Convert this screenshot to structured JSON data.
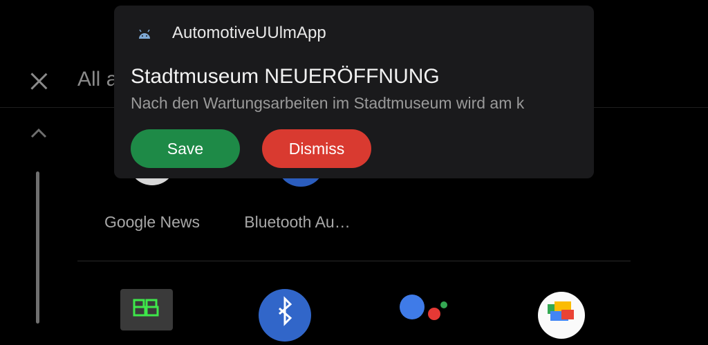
{
  "launcher": {
    "header_title": "All apps",
    "apps_row1": [
      {
        "label": "Google News",
        "icon": "google-news-icon"
      },
      {
        "label": "Bluetooth Au…",
        "icon": "bluetooth-audio-icon"
      }
    ],
    "apps_row2_icons": [
      "app-green-icon",
      "bluetooth-icon",
      "google-assistant-icon",
      "google-photos-icon"
    ]
  },
  "notification": {
    "app_name": "AutomotiveUUlmApp",
    "app_icon": "android-icon",
    "title": "Stadtmuseum NEUERÖFFNUNG",
    "body": "Nach den Wartungsarbeiten im Stadtmuseum wird am k",
    "actions": {
      "save_label": "Save",
      "dismiss_label": "Dismiss"
    }
  },
  "colors": {
    "save": "#1e8a47",
    "dismiss": "#d93a30",
    "card": "#1a1a1c"
  }
}
